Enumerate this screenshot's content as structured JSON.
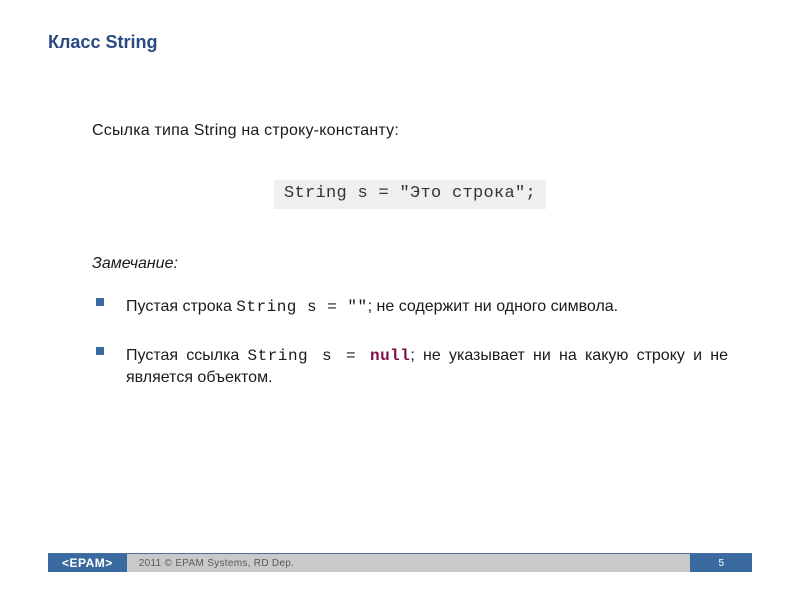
{
  "title": "Класс String",
  "intro": "Ссылка типа String на строку-константу:",
  "code_example": "String s = \"Это строка\";",
  "note_label": "Замечание:",
  "bullets": [
    {
      "pre": "Пустая строка ",
      "code": "String s = \"\"",
      "post": ";  не содержит ни одного символа."
    },
    {
      "pre": "Пустая ссылка ",
      "code": "String s = ",
      "keyword": "null",
      "post": "; не указывает ни на какую строку и не является объектом."
    }
  ],
  "footer": {
    "logo": "<EPAM>",
    "copyright": "2011 © EPAM Systems, RD Dep.",
    "page": "5"
  }
}
